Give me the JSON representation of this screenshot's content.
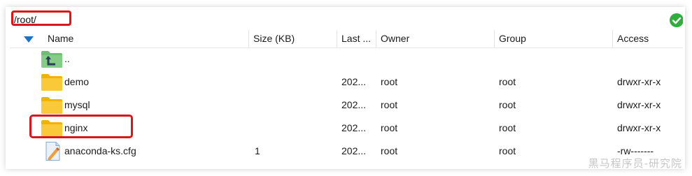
{
  "path_bar": {
    "value": "/root/",
    "status_icon": "check-circle-icon",
    "status_color": "#2fae3b"
  },
  "columns": {
    "name": "Name",
    "size": "Size (KB)",
    "last_modified": "Last ...",
    "owner": "Owner",
    "group": "Group",
    "access": "Access"
  },
  "sort_indicator": "sort-descending-icon",
  "rows": [
    {
      "icon": "parent-folder-icon",
      "name": "..",
      "size": "",
      "last_modified": "",
      "owner": "",
      "group": "",
      "access": ""
    },
    {
      "icon": "folder-icon",
      "name": "demo",
      "size": "",
      "last_modified": "202...",
      "owner": "root",
      "group": "root",
      "access": "drwxr-xr-x"
    },
    {
      "icon": "folder-icon",
      "name": "mysql",
      "size": "",
      "last_modified": "202...",
      "owner": "root",
      "group": "root",
      "access": "drwxr-xr-x"
    },
    {
      "icon": "folder-icon",
      "name": "nginx",
      "size": "",
      "last_modified": "202...",
      "owner": "root",
      "group": "root",
      "access": "drwxr-xr-x"
    },
    {
      "icon": "config-file-icon",
      "name": "anaconda-ks.cfg",
      "size": "1",
      "last_modified": "202...",
      "owner": "root",
      "group": "root",
      "access": "-rw-------"
    }
  ],
  "watermark": "黑马程序员-研究院",
  "colors": {
    "highlight": "#d9161c",
    "folder": "#f5c518",
    "parent_folder": "#6fbf73",
    "sort_arrow": "#1a73c9"
  }
}
